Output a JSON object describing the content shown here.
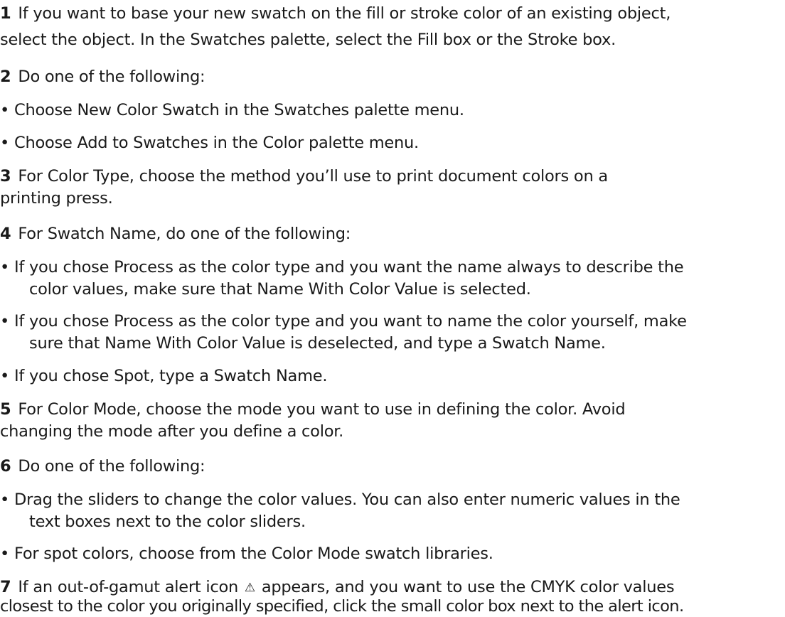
{
  "steps": [
    {
      "number": "1",
      "lines": [
        "If you want to base your new swatch on the fill or stroke color of an existing object,",
        "select the object. In the Swatches palette, select the Fill box or the Stroke box."
      ]
    },
    {
      "number": "2",
      "lines": [
        "Do one of the following:"
      ],
      "bullets": [
        [
          "Choose New Color Swatch in the Swatches palette menu."
        ],
        [
          "Choose Add to Swatches in the Color palette menu."
        ]
      ]
    },
    {
      "number": "3",
      "lines": [
        "For Color Type, choose the method you’ll use to print document colors on a",
        "printing press."
      ]
    },
    {
      "number": "4",
      "lines": [
        "For Swatch Name, do one of the following:"
      ],
      "bullets": [
        [
          "If you chose Process as the color type and you want the name always to describe the",
          "color values, make sure that Name With Color Value is selected."
        ],
        [
          "If you chose Process as the color type and you want to name the color yourself, make",
          "sure that Name With Color Value is deselected, and type a Swatch Name."
        ],
        [
          "If you chose Spot, type a Swatch Name."
        ]
      ]
    },
    {
      "number": "5",
      "lines": [
        "For Color Mode, choose the mode you want to use in defining the color. Avoid",
        "changing the mode after you define a color."
      ]
    },
    {
      "number": "6",
      "lines": [
        "Do one of the following:"
      ],
      "bullets": [
        [
          "Drag the sliders to change the color values. You can also enter numeric values in the",
          "text boxes next to the color sliders."
        ],
        [
          "For spot colors, choose from the Color Mode swatch libraries."
        ]
      ]
    },
    {
      "number": "7",
      "lines_before_icon": "If an out-of-gamut alert icon",
      "icon_name": "warning-triangle-icon",
      "icon_glyph": "⚠",
      "lines_after_icon": "appears, and you want to use the CMYK color values",
      "line2": "closest to the color you originally specified, click the small color box next to the alert icon."
    }
  ],
  "bullet_char": "•"
}
